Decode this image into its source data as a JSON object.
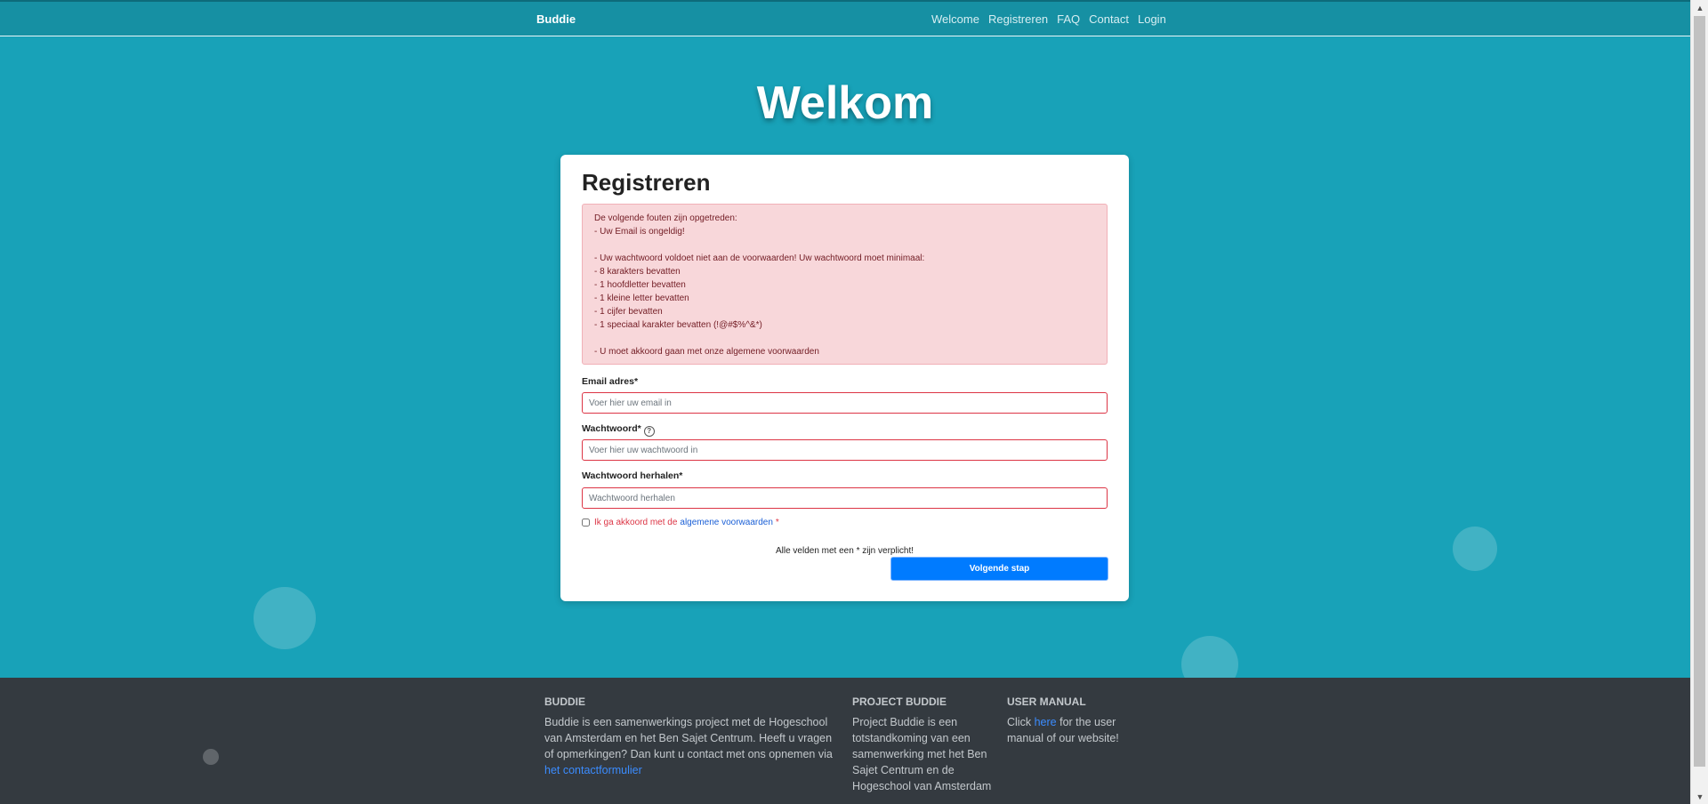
{
  "navbar": {
    "brand": "Buddie",
    "links": [
      "Welcome",
      "Registreren",
      "FAQ",
      "Contact",
      "Login"
    ]
  },
  "hero": {
    "title": "Welkom"
  },
  "form": {
    "title": "Registreren",
    "errors": [
      "De volgende fouten zijn opgetreden:",
      "- Uw Email is ongeldig!",
      "",
      "- Uw wachtwoord voldoet niet aan de voorwaarden! Uw wachtwoord moet minimaal:",
      "- 8 karakters bevatten",
      "- 1 hoofdletter bevatten",
      "- 1 kleine letter bevatten",
      "- 1 cijfer bevatten",
      "- 1 speciaal karakter bevatten (!@#$%^&*)",
      "",
      "- U moet akkoord gaan met onze algemene voorwaarden"
    ],
    "email": {
      "label": "Email adres*",
      "placeholder": "Voer hier uw email in"
    },
    "password": {
      "label": "Wachtwoord*",
      "help_icon": "?",
      "placeholder": "Voer hier uw wachtwoord in"
    },
    "password_repeat": {
      "label": "Wachtwoord herhalen*",
      "placeholder": "Wachtwoord herhalen"
    },
    "terms": {
      "text": "Ik ga akkoord met de",
      "link": "algemene voorwaarden",
      "star": "*"
    },
    "required_note": "Alle velden met een * zijn verplicht!",
    "submit_label": "Volgende stap"
  },
  "footer": {
    "col1": {
      "heading": "BUDDIE",
      "text": "Buddie is een samenwerkings project met de Hogeschool van Amsterdam en het Ben Sajet Centrum. Heeft u vragen of opmerkingen? Dan kunt u contact met ons opnemen via",
      "link": "het contactformulier"
    },
    "col2": {
      "heading": "PROJECT BUDDIE",
      "text": "Project Buddie is een totstandkoming van een samenwerking met het Ben Sajet Centrum en de Hogeschool van Amsterdam"
    },
    "col3": {
      "heading": "USER MANUAL",
      "prefix": "Click",
      "link": "here",
      "suffix": "for the user manual of our website!"
    }
  },
  "colors": {
    "background": "#18a2b8",
    "navbar": "#1690a3",
    "error_bg": "#f8d7da",
    "error_text": "#721c24",
    "invalid_border": "#dc3545",
    "primary": "#007bff",
    "footer": "#343a40"
  },
  "icons": {
    "scroll_up": "scroll-up-arrow-icon",
    "scroll_down": "scroll-down-arrow-icon",
    "help": "question-circle-icon"
  }
}
